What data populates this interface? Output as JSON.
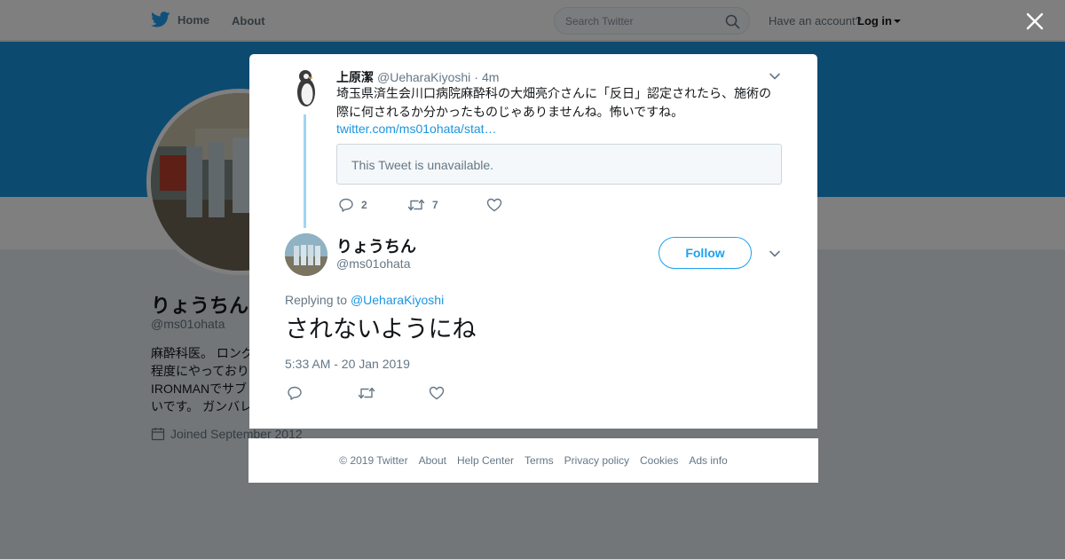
{
  "topbar": {
    "home_label": "Home",
    "about_label": "About",
    "search_placeholder": "Search Twitter",
    "have_account": "Have an account?",
    "login_label": "Log in"
  },
  "profile": {
    "name": "りょうちん",
    "handle": "@ms01ohata",
    "bio_lines": [
      "麻酔科医。 ロング",
      "程度にやっており",
      "IRONMANでサブ",
      "いです。 ガンバレ"
    ],
    "joined": "Joined September 2012"
  },
  "parent_tweet": {
    "name": "上原潔",
    "handle": "@UeharaKiyoshi",
    "separator": "·",
    "time": "4m",
    "text_lines": [
      "埼玉県済生会川口病院麻酔科の大畑亮介さんに「反日」認定されたら、施術の",
      "際に何されるか分かったものじゃありませんね。怖いですね。"
    ],
    "link": "twitter.com/ms01ohata/stat…",
    "quote_unavailable": "This Tweet is unavailable.",
    "reply_count": "2",
    "retweet_count": "7"
  },
  "main_tweet": {
    "name": "りょうちん",
    "handle": "@ms01ohata",
    "follow_label": "Follow",
    "replying_prefix": "Replying to",
    "replying_to": "@UeharaKiyoshi",
    "text": "されないようにね",
    "timestamp": "5:33 AM - 20 Jan 2019"
  },
  "footer": {
    "links": [
      "© 2019 Twitter",
      "About",
      "Help Center",
      "Terms",
      "Privacy policy",
      "Cookies",
      "Ads info"
    ]
  },
  "colors": {
    "brand_blue": "#1da1f2",
    "link_blue": "#1b95e0",
    "banner_blue": "#1b95e0",
    "thread_line": "#a3d4f2",
    "secondary_text": "#657786"
  },
  "icons": {
    "logo": "twitter-bird-icon",
    "search": "search-icon",
    "close": "close-icon",
    "caret": "chevron-down-icon",
    "reply": "reply-icon",
    "retweet": "retweet-icon",
    "like": "heart-icon",
    "calendar": "calendar-icon"
  }
}
